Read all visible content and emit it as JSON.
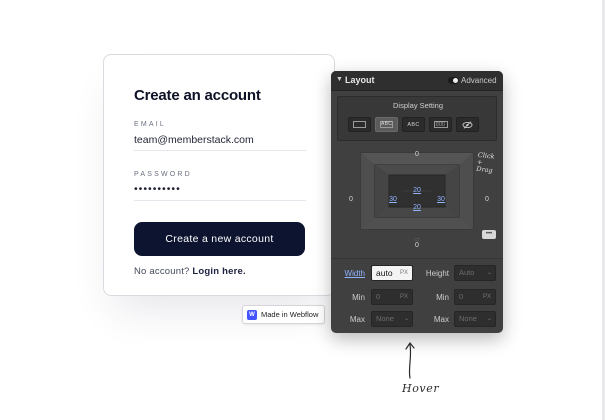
{
  "card": {
    "title": "Create an account",
    "email_label": "EMAIL",
    "email_value": "team@memberstack.com",
    "password_label": "PASSWORD",
    "password_value": "••••••••••",
    "cta_label": "Create a new account",
    "no_account_text": "No account?",
    "login_link": "Login here."
  },
  "badge": {
    "logo": "W",
    "label": "Made in Webflow"
  },
  "panel": {
    "title": "Layout",
    "advanced_label": "Advanced",
    "display_setting_label": "Display Setting",
    "display_options": [
      {
        "icon": "block-icon",
        "label": "",
        "selected": false
      },
      {
        "icon": "inline-block-icon",
        "label": "ABC",
        "selected": true
      },
      {
        "icon": "inline-icon",
        "label": "ABC",
        "selected": false
      },
      {
        "icon": "flex-icon",
        "label": "",
        "selected": false
      },
      {
        "icon": "hidden-eye-icon",
        "label": "",
        "selected": false
      }
    ],
    "spacing": {
      "margin_top": "0",
      "margin_right": "0",
      "margin_bottom": "0",
      "margin_left": "0",
      "padding_top": "20",
      "padding_right": "30",
      "padding_bottom": "20",
      "padding_left": "30"
    },
    "click_drag_note": "Click + Drag",
    "more_button": "•••",
    "width_label": "Width",
    "width_value": "auto",
    "width_unit": "PX",
    "height_label": "Height",
    "height_value": "Auto",
    "min_label": "Min",
    "min_width_value": "0",
    "min_height_value": "0",
    "min_unit": "PX",
    "max_label": "Max",
    "max_width_value": "None",
    "max_height_value": "None"
  },
  "annotation": {
    "hover_text": "Hover"
  }
}
